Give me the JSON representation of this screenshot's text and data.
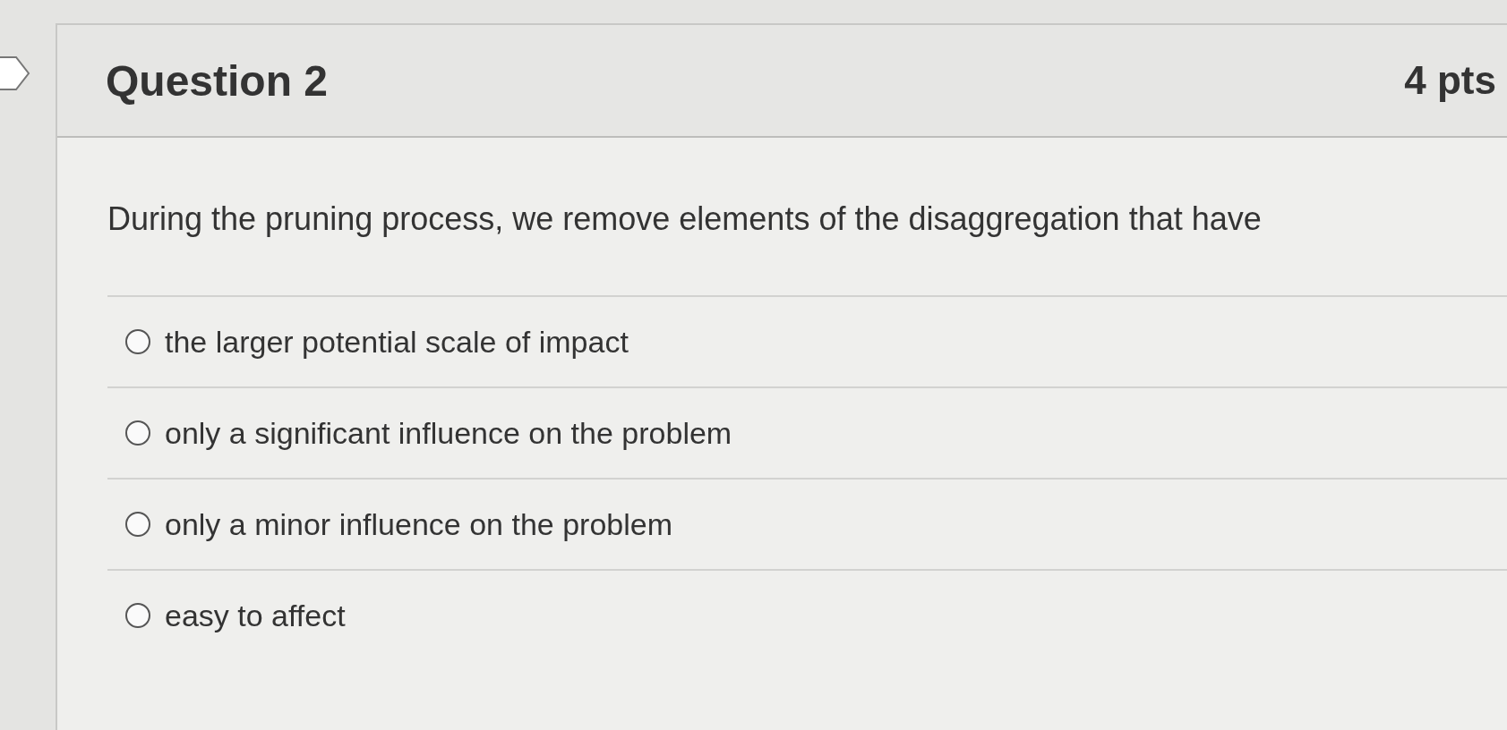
{
  "question": {
    "title": "Question 2",
    "points": "4 pts",
    "text": "During the pruning process, we remove elements of the disaggregation that have",
    "answers": [
      {
        "label": "the larger potential scale of impact",
        "selected": false
      },
      {
        "label": "only a significant influence on the problem",
        "selected": false
      },
      {
        "label": "only a minor influence on the problem",
        "selected": false
      },
      {
        "label": "easy to affect",
        "selected": false
      }
    ]
  }
}
